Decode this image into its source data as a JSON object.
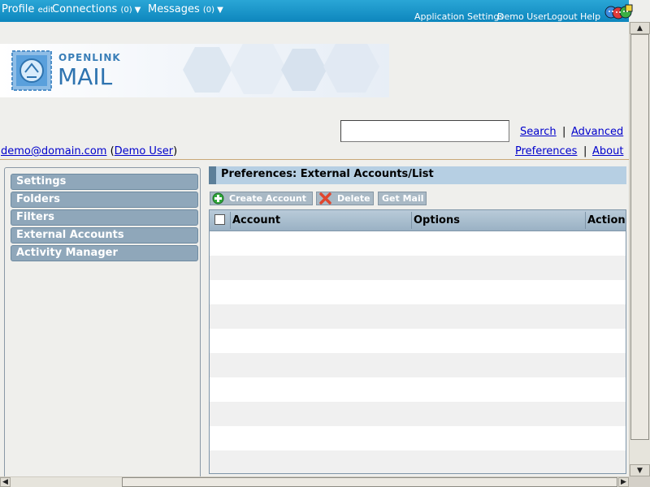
{
  "topbar": {
    "profile": "Profile",
    "edit": "edit",
    "connections": "Connections",
    "connections_count": "(0)",
    "messages": "Messages",
    "messages_count": "(0)",
    "caret": "▼",
    "links": [
      "Application Settings",
      "Demo User",
      "Logout",
      "Help"
    ]
  },
  "banner": {
    "line1": "OPENLINK",
    "line2": "MAIL"
  },
  "search": {
    "value": "",
    "search_link": "Search",
    "separator": "|",
    "advanced_link": "Advanced"
  },
  "user": {
    "email": "demo@domain.com",
    "open_paren": "(",
    "name": "Demo User",
    "close_paren": ")"
  },
  "right_links": {
    "preferences": "Preferences",
    "separator": "|",
    "about": "About"
  },
  "sidebar": {
    "items": [
      "Settings",
      "Folders",
      "Filters",
      "External Accounts",
      "Activity Manager"
    ]
  },
  "content": {
    "title": "Preferences: External Accounts/List",
    "toolbar": {
      "create": "Create Account",
      "delete": "Delete",
      "get_mail": "Get Mail"
    },
    "columns": [
      "Account",
      "Options",
      "Action"
    ],
    "rows": []
  },
  "colors": {
    "topbar": "#1b98cc",
    "nav_button": "#8fa7ba",
    "title_bar": "#b6cfe3",
    "stripe": "#f0f0f0"
  }
}
